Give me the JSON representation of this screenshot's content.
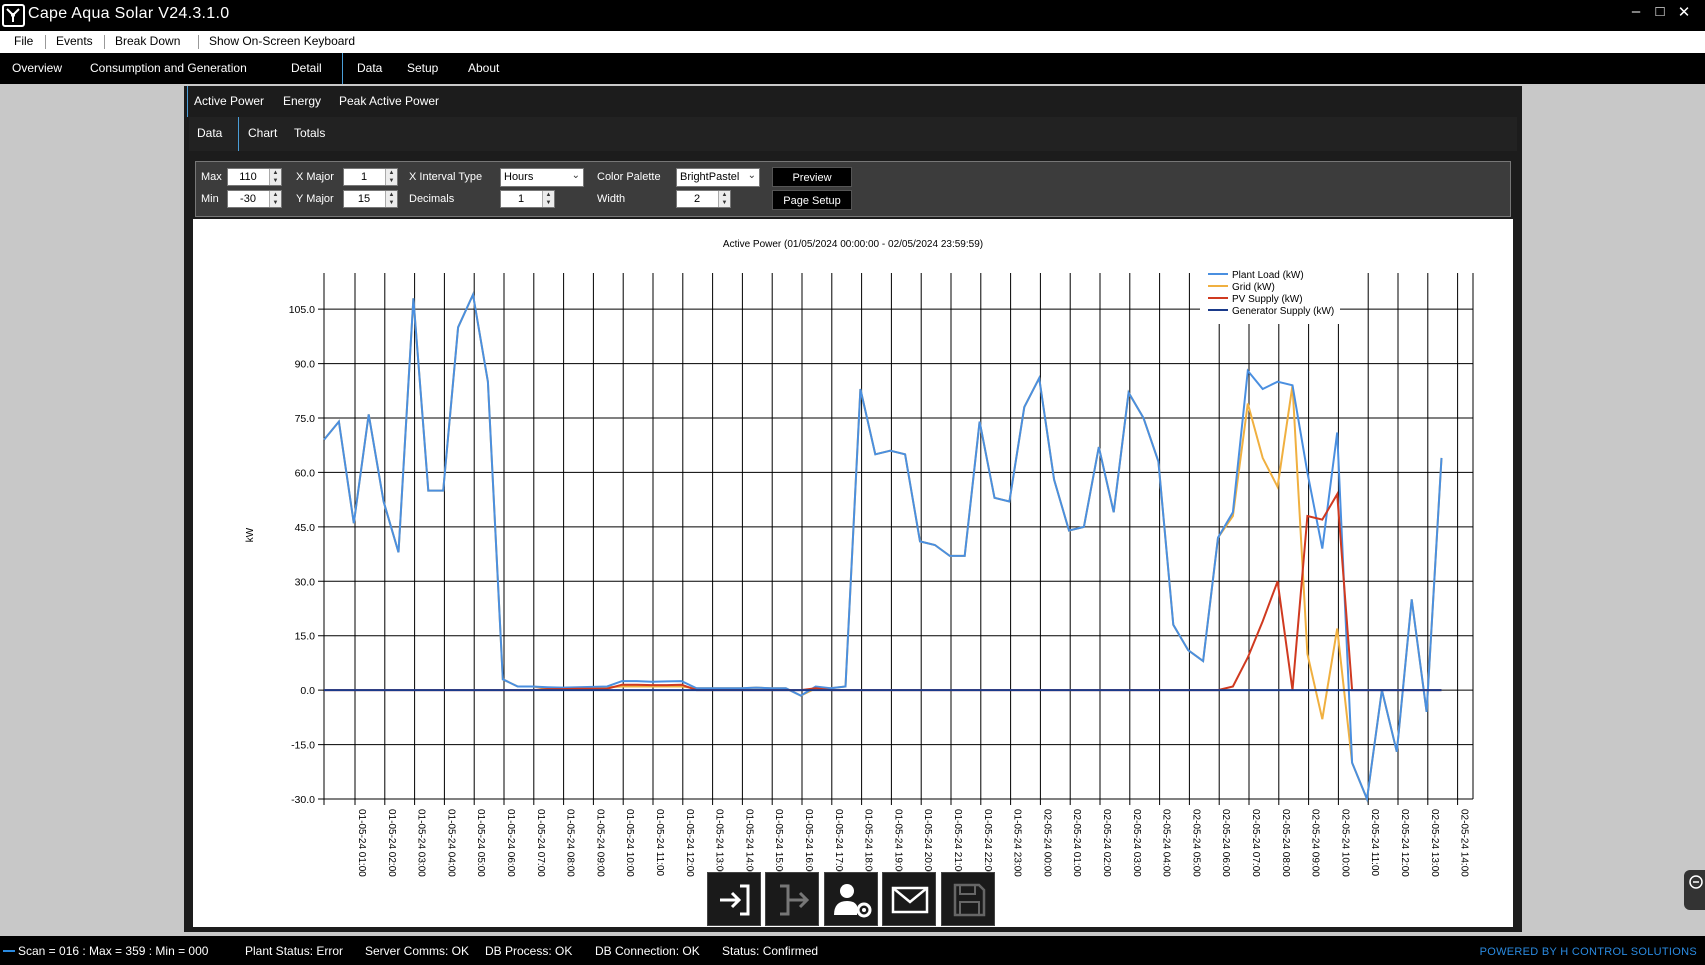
{
  "window": {
    "title": "Cape Aqua Solar V24.3.1.0"
  },
  "menu": [
    "File",
    "Events",
    "Break Down",
    "Show On-Screen Keyboard"
  ],
  "nav": [
    "Overview",
    "Consumption and Generation",
    "Detail",
    "Data",
    "Setup",
    "About"
  ],
  "subtabs": [
    "Active Power",
    "Energy",
    "Peak Active Power"
  ],
  "viewtabs": [
    "Data",
    "Chart",
    "Totals"
  ],
  "controls": {
    "max_label": "Max",
    "max_value": "110",
    "min_label": "Min",
    "min_value": "-30",
    "xmajor_label": "X Major",
    "xmajor_value": "1",
    "ymajor_label": "Y Major",
    "ymajor_value": "15",
    "xinterval_label": "X Interval Type",
    "xinterval_value": "Hours",
    "decimals_label": "Decimals",
    "decimals_value": "1",
    "palette_label": "Color Palette",
    "palette_value": "BrightPastel",
    "width_label": "Width",
    "width_value": "2",
    "preview_label": "Preview",
    "pagesetup_label": "Page Setup"
  },
  "chart_data": {
    "type": "line",
    "title": "Active Power   (01/05/2024 00:00:00 - 02/05/2024 23:59:59)",
    "ylabel": "kW",
    "xlabel": "",
    "ylim": [
      -30,
      110
    ],
    "yticks": [
      "105.0",
      "90.0",
      "75.0",
      "60.0",
      "45.0",
      "30.0",
      "15.0",
      "0.0",
      "-15.0",
      "-30.0"
    ],
    "ytick_values": [
      105,
      90,
      75,
      60,
      45,
      30,
      15,
      0,
      -15,
      -30
    ],
    "x_ticks": [
      "01-05-24 01:00",
      "01-05-24 02:00",
      "01-05-24 03:00",
      "01-05-24 04:00",
      "01-05-24 05:00",
      "01-05-24 06:00",
      "01-05-24 07:00",
      "01-05-24 08:00",
      "01-05-24 09:00",
      "01-05-24 10:00",
      "01-05-24 11:00",
      "01-05-24 12:00",
      "01-05-24 13:00",
      "01-05-24 14:00",
      "01-05-24 15:00",
      "01-05-24 16:00",
      "01-05-24 17:00",
      "01-05-24 18:00",
      "01-05-24 19:00",
      "01-05-24 20:00",
      "01-05-24 21:00",
      "01-05-24 22:00",
      "01-05-24 23:00",
      "02-05-24 00:00",
      "02-05-24 01:00",
      "02-05-24 02:00",
      "02-05-24 03:00",
      "02-05-24 04:00",
      "02-05-24 05:00",
      "02-05-24 06:00",
      "02-05-24 07:00",
      "02-05-24 08:00",
      "02-05-24 09:00",
      "02-05-24 10:00",
      "02-05-24 11:00",
      "02-05-24 12:00",
      "02-05-24 13:00",
      "02-05-24 14:00"
    ],
    "x_hours": [
      0,
      0.5,
      1,
      1.5,
      2,
      2.5,
      3,
      3.5,
      4,
      4.5,
      5,
      5.5,
      6,
      6.5,
      7,
      7.5,
      8,
      8.5,
      9,
      9.5,
      10,
      10.5,
      11,
      11.5,
      12,
      12.5,
      13,
      13.5,
      14,
      14.5,
      15,
      15.5,
      16,
      16.5,
      17,
      17.5,
      18,
      18.5,
      19,
      19.5,
      20,
      20.5,
      21,
      21.5,
      22,
      22.5,
      23,
      23.5,
      24,
      24.5,
      25,
      25.5,
      26,
      26.5,
      27,
      27.5,
      28,
      28.5,
      29,
      29.5,
      30,
      30.5,
      31,
      31.5,
      32,
      32.5,
      33,
      33.5,
      34,
      34.5,
      35,
      35.5,
      36,
      36.5,
      37,
      37.5,
      38,
      38.5,
      39
    ],
    "x_start": "01-05-24 00:00",
    "legend_position": "top-right",
    "grid": true,
    "series": [
      {
        "name": "Plant Load (kW)",
        "color": "#4a8fe0",
        "values": [
          69,
          74,
          46,
          76,
          52,
          38,
          108,
          55,
          55,
          100,
          109,
          85,
          3,
          1,
          1,
          0.8,
          0.7,
          0.8,
          0.9,
          1,
          2.5,
          2.5,
          2.3,
          2.4,
          2.5,
          0.5,
          0.5,
          0.5,
          0.5,
          0.7,
          0.5,
          0.5,
          -1.5,
          1,
          0.5,
          1,
          83,
          65,
          66,
          65,
          41,
          40,
          37,
          37,
          74,
          53,
          52,
          78,
          86,
          58,
          44,
          45,
          67,
          49,
          82,
          75,
          63,
          18,
          11,
          8,
          42,
          49,
          88,
          83,
          85,
          84,
          60,
          39,
          71,
          -20,
          -30,
          0,
          -17,
          25,
          -6,
          64
        ]
      },
      {
        "name": "Grid (kW)",
        "color": "#f0b040",
        "values": [
          69,
          74,
          46,
          76,
          52,
          38,
          108,
          55,
          55,
          100,
          109,
          85,
          3,
          1,
          1,
          0.5,
          0.5,
          0.5,
          0.6,
          0.8,
          1,
          1,
          1,
          1,
          1,
          0.5,
          0.5,
          0.5,
          0.5,
          0.7,
          0.5,
          0.5,
          -1.5,
          0.5,
          0.5,
          1,
          83,
          65,
          66,
          65,
          41,
          40,
          37,
          37,
          74,
          53,
          52,
          78,
          86,
          58,
          44,
          45,
          67,
          49,
          82,
          75,
          63,
          18,
          11,
          8,
          42,
          48,
          79,
          64,
          56,
          84,
          10,
          -8,
          17,
          -20,
          -30,
          0,
          -17,
          25,
          -6,
          64
        ]
      },
      {
        "name": "PV Supply (kW)",
        "color": "#d03a20",
        "values": [
          0,
          0,
          0,
          0,
          0,
          0,
          0,
          0,
          0,
          0,
          0,
          0,
          0,
          0,
          0,
          0.3,
          0.3,
          0.4,
          0.4,
          0.4,
          1.5,
          1.5,
          1.4,
          1.4,
          1.5,
          0,
          0,
          0,
          0,
          0,
          0,
          0,
          0,
          0.5,
          0,
          0,
          0,
          0,
          0,
          0,
          0,
          0,
          0,
          0,
          0,
          0,
          0,
          0,
          0,
          0,
          0,
          0,
          0,
          0,
          0,
          0,
          0,
          0,
          0,
          0,
          0,
          1,
          9,
          19,
          30,
          0,
          48,
          47,
          54,
          0,
          0,
          0,
          0,
          0,
          0,
          0
        ]
      },
      {
        "name": "Generator Supply (kW)",
        "color": "#1a3a8a",
        "values": [
          0,
          0,
          0,
          0,
          0,
          0,
          0,
          0,
          0,
          0,
          0,
          0,
          0,
          0,
          0,
          0,
          0,
          0,
          0,
          0,
          0,
          0,
          0,
          0,
          0,
          0,
          0,
          0,
          0,
          0,
          0,
          0,
          0,
          0,
          0,
          0,
          0,
          0,
          0,
          0,
          0,
          0,
          0,
          0,
          0,
          0,
          0,
          0,
          0,
          0,
          0,
          0,
          0,
          0,
          0,
          0,
          0,
          0,
          0,
          0,
          0,
          0,
          0,
          0,
          0,
          0,
          0,
          0,
          0,
          0,
          0,
          0,
          0,
          0,
          0,
          0
        ]
      }
    ]
  },
  "toolbar_icons": [
    "login-icon",
    "logout-icon",
    "user-settings-icon",
    "mail-icon",
    "save-icon"
  ],
  "status": {
    "scan": "Scan = 016 : Max = 359 : Min = 000",
    "plant": "Plant Status: Error",
    "server": "Server Comms: OK",
    "dbprocess": "DB Process:  OK",
    "dbconn": "DB Connection:  OK",
    "state": "Status:  Confirmed",
    "brand": "POWERED BY H CONTROL SOLUTIONS"
  }
}
